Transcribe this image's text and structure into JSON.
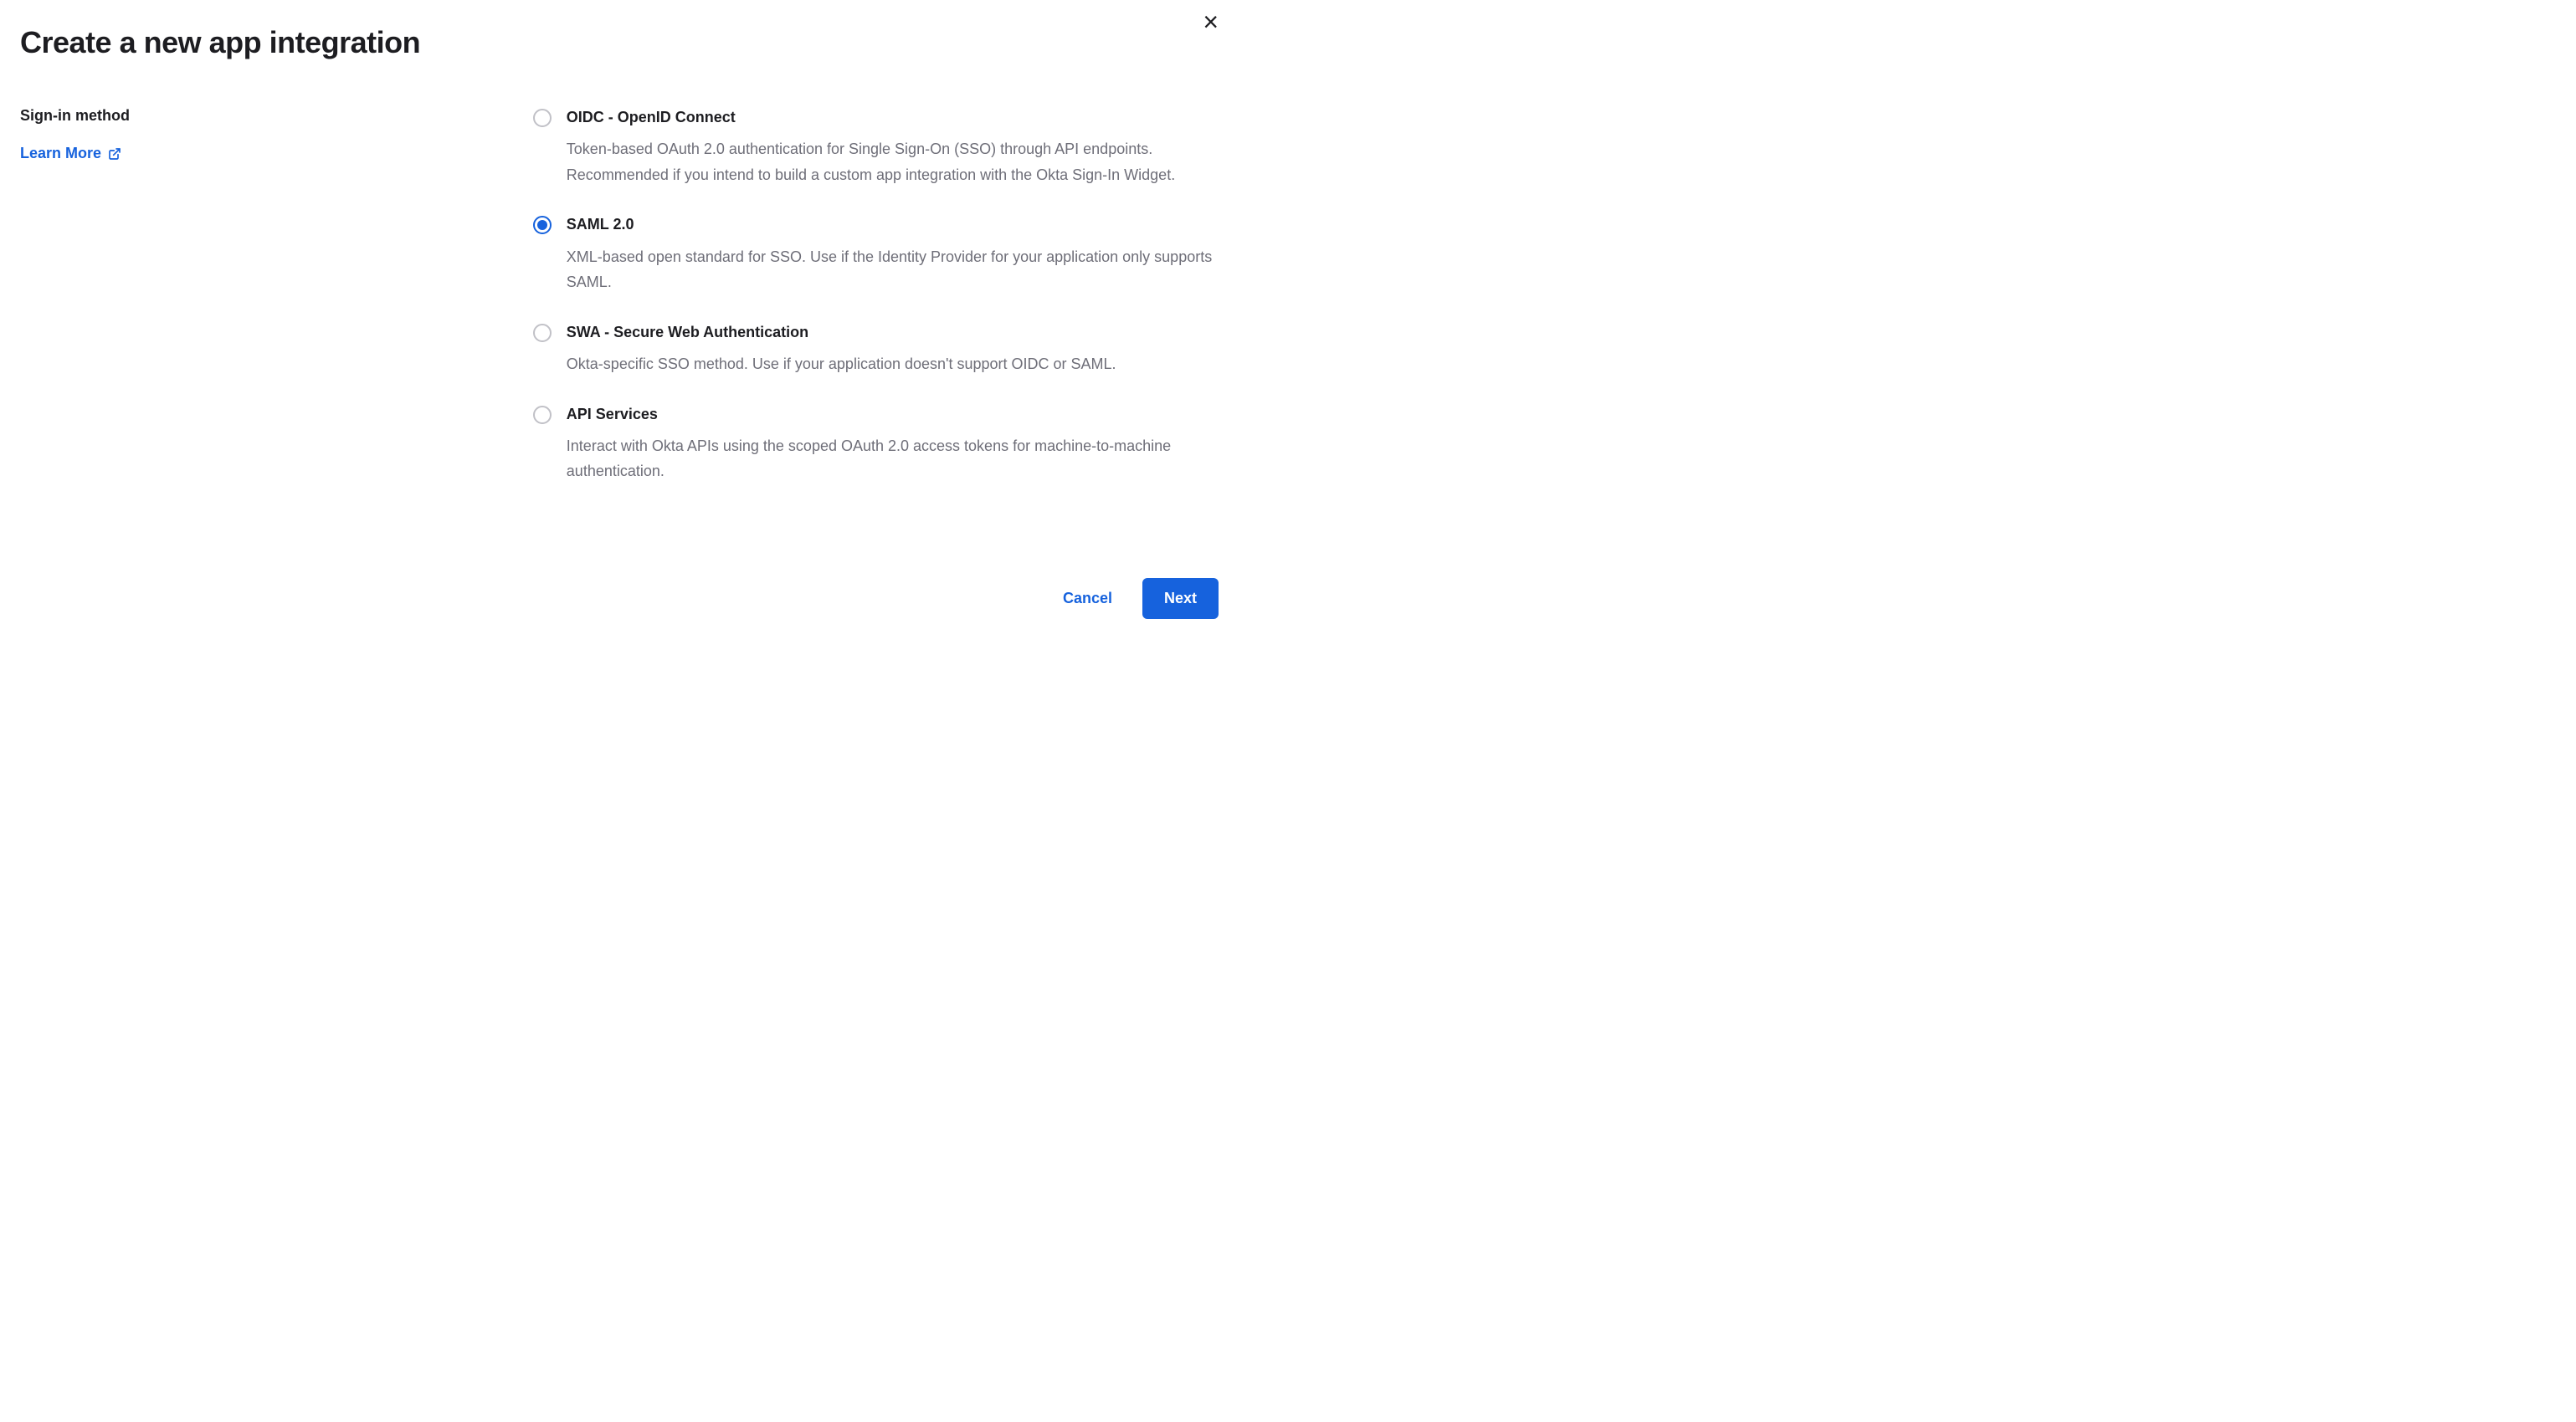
{
  "dialog": {
    "title": "Create a new app integration",
    "close_label": "×"
  },
  "section": {
    "label": "Sign-in method",
    "learn_more": "Learn More"
  },
  "options": [
    {
      "label": "OIDC - OpenID Connect",
      "description": "Token-based OAuth 2.0 authentication for Single Sign-On (SSO) through API endpoints. Recommended if you intend to build a custom app integration with the Okta Sign-In Widget.",
      "selected": false
    },
    {
      "label": "SAML 2.0",
      "description": "XML-based open standard for SSO. Use if the Identity Provider for your application only supports SAML.",
      "selected": true
    },
    {
      "label": "SWA - Secure Web Authentication",
      "description": "Okta-specific SSO method. Use if your application doesn't support OIDC or SAML.",
      "selected": false
    },
    {
      "label": "API Services",
      "description": "Interact with Okta APIs using the scoped OAuth 2.0 access tokens for machine-to-machine authentication.",
      "selected": false
    }
  ],
  "footer": {
    "cancel": "Cancel",
    "next": "Next"
  }
}
